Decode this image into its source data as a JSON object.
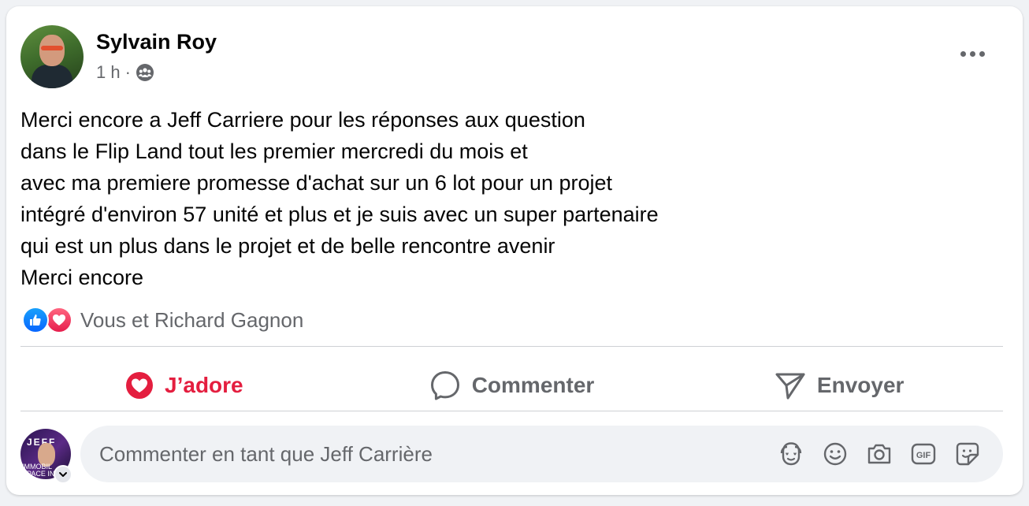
{
  "post": {
    "author": "Sylvain Roy",
    "time": "1 h",
    "separator": "·",
    "lines": [
      "Merci encore a Jeff Carriere pour les réponses aux question",
      "dans le Flip Land tout les premier mercredi du mois et",
      "avec ma premiere promesse d'achat sur un 6 lot pour un projet",
      "intégré d'environ 57 unité et plus et je suis avec un super partenaire",
      "qui est un plus dans le projet et de belle rencontre avenir",
      "Merci encore"
    ],
    "reactions_text": "Vous et Richard Gagnon"
  },
  "actions": {
    "love_label": "J’adore",
    "comment_label": "Commenter",
    "send_label": "Envoyer"
  },
  "comment": {
    "placeholder": "Commenter en tant que Jeff Carrière",
    "avatar_text": "JEFF",
    "avatar_sub": "IMMOBIL SPACE IN"
  },
  "colors": {
    "love": "#e41e3f",
    "like": "#0866ff",
    "muted": "#65676b"
  },
  "icons": [
    "group-icon",
    "more-icon",
    "like-reaction-icon",
    "love-reaction-icon",
    "heart-icon",
    "comment-icon",
    "send-icon",
    "chevron-down-icon",
    "avatar-sticker-icon",
    "emoji-icon",
    "camera-icon",
    "gif-icon",
    "sticker-icon"
  ]
}
